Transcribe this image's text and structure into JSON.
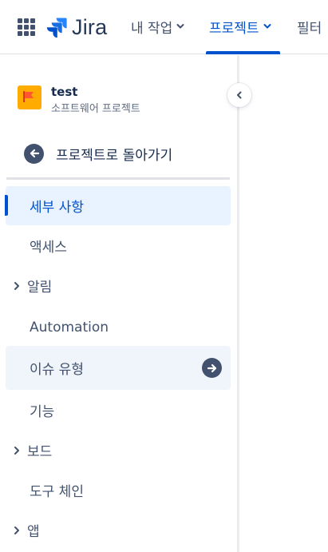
{
  "topnav": {
    "app_name": "Jira",
    "items": [
      {
        "label": "내 작업"
      },
      {
        "label": "프로젝트"
      },
      {
        "label": "필터"
      }
    ]
  },
  "project": {
    "name": "test",
    "type": "소프트웨어 프로젝트"
  },
  "sidebar": {
    "back_label": "프로젝트로 돌아가기",
    "items": [
      {
        "label": "세부 사항"
      },
      {
        "label": "액세스"
      },
      {
        "label": "알림"
      },
      {
        "label": "Automation"
      },
      {
        "label": "이슈 유형"
      },
      {
        "label": "기능"
      },
      {
        "label": "보드"
      },
      {
        "label": "도구 체인"
      },
      {
        "label": "앱"
      }
    ]
  },
  "colors": {
    "accent": "#0052cc",
    "selected_bg": "#e9f2ff",
    "project_avatar": "#ffab00"
  }
}
